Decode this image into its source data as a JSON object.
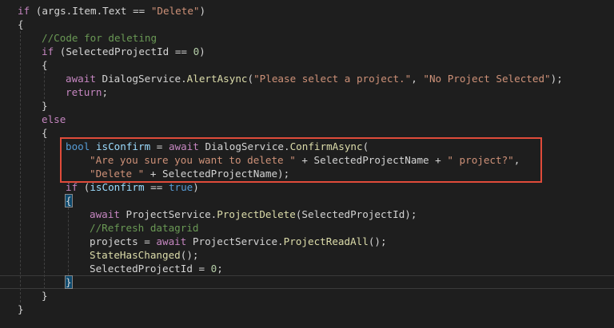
{
  "theme": {
    "background": "#1e1e1e",
    "default_text": "#d4d4d4",
    "keyword": "#569cd6",
    "control": "#c586c0",
    "function": "#dcdcaa",
    "string": "#ce9178",
    "comment": "#6a9955",
    "number": "#b5cea8",
    "variable": "#9cdcfe",
    "highlight_box": "#e04b3a"
  },
  "lines": [
    [
      {
        "t": "if",
        "c": "ctrl"
      },
      {
        "t": " (args.Item.Text == ",
        "c": "plain"
      },
      {
        "t": "\"Delete\"",
        "c": "str"
      },
      {
        "t": ")",
        "c": "plain"
      }
    ],
    [
      {
        "t": "{",
        "c": "plain"
      }
    ],
    [
      {
        "t": "//Code for deleting",
        "c": "cmt"
      }
    ],
    [
      {
        "t": "if",
        "c": "ctrl"
      },
      {
        "t": " (SelectedProjectId == ",
        "c": "plain"
      },
      {
        "t": "0",
        "c": "num"
      },
      {
        "t": ")",
        "c": "plain"
      }
    ],
    [
      {
        "t": "{",
        "c": "plain"
      }
    ],
    [
      {
        "t": "await",
        "c": "ctrl"
      },
      {
        "t": " DialogService.",
        "c": "plain"
      },
      {
        "t": "AlertAsync",
        "c": "fn"
      },
      {
        "t": "(",
        "c": "plain"
      },
      {
        "t": "\"Please select a project.\"",
        "c": "str"
      },
      {
        "t": ", ",
        "c": "plain"
      },
      {
        "t": "\"No Project Selected\"",
        "c": "str"
      },
      {
        "t": ");",
        "c": "plain"
      }
    ],
    [
      {
        "t": "return",
        "c": "ctrl"
      },
      {
        "t": ";",
        "c": "plain"
      }
    ],
    [
      {
        "t": "}",
        "c": "plain"
      }
    ],
    [
      {
        "t": "else",
        "c": "ctrl"
      }
    ],
    [
      {
        "t": "{",
        "c": "plain"
      }
    ],
    [
      {
        "t": "bool",
        "c": "kw"
      },
      {
        "t": " ",
        "c": "plain"
      },
      {
        "t": "isConfirm",
        "c": "var"
      },
      {
        "t": " = ",
        "c": "plain"
      },
      {
        "t": "await",
        "c": "ctrl"
      },
      {
        "t": " DialogService.",
        "c": "plain"
      },
      {
        "t": "ConfirmAsync",
        "c": "fn"
      },
      {
        "t": "(",
        "c": "plain"
      }
    ],
    [
      {
        "t": "\"Are you sure you want to delete \"",
        "c": "str"
      },
      {
        "t": " + SelectedProjectName + ",
        "c": "plain"
      },
      {
        "t": "\" project?\"",
        "c": "str"
      },
      {
        "t": ",",
        "c": "plain"
      }
    ],
    [
      {
        "t": "\"Delete \"",
        "c": "str"
      },
      {
        "t": " + SelectedProjectName);",
        "c": "plain"
      }
    ],
    [
      {
        "t": "if",
        "c": "ctrl"
      },
      {
        "t": " (",
        "c": "plain"
      },
      {
        "t": "isConfirm",
        "c": "var"
      },
      {
        "t": " == ",
        "c": "plain"
      },
      {
        "t": "true",
        "c": "kw"
      },
      {
        "t": ")",
        "c": "plain"
      }
    ],
    [
      {
        "t": "{",
        "c": "plain",
        "m": true
      }
    ],
    [
      {
        "t": "await",
        "c": "ctrl"
      },
      {
        "t": " ProjectService.",
        "c": "plain"
      },
      {
        "t": "ProjectDelete",
        "c": "fn"
      },
      {
        "t": "(SelectedProjectId);",
        "c": "plain"
      }
    ],
    [
      {
        "t": "//Refresh datagrid",
        "c": "cmt"
      }
    ],
    [
      {
        "t": "projects = ",
        "c": "plain"
      },
      {
        "t": "await",
        "c": "ctrl"
      },
      {
        "t": " ProjectService.",
        "c": "plain"
      },
      {
        "t": "ProjectReadAll",
        "c": "fn"
      },
      {
        "t": "();",
        "c": "plain"
      }
    ],
    [
      {
        "t": "StateHasChanged",
        "c": "fn"
      },
      {
        "t": "();",
        "c": "plain"
      }
    ],
    [
      {
        "t": "SelectedProjectId = ",
        "c": "plain"
      },
      {
        "t": "0",
        "c": "num"
      },
      {
        "t": ";",
        "c": "plain"
      }
    ],
    [
      {
        "t": "}",
        "c": "plain",
        "m": true
      }
    ],
    [
      {
        "t": "}",
        "c": "plain"
      }
    ],
    [
      {
        "t": "}",
        "c": "plain"
      }
    ]
  ]
}
